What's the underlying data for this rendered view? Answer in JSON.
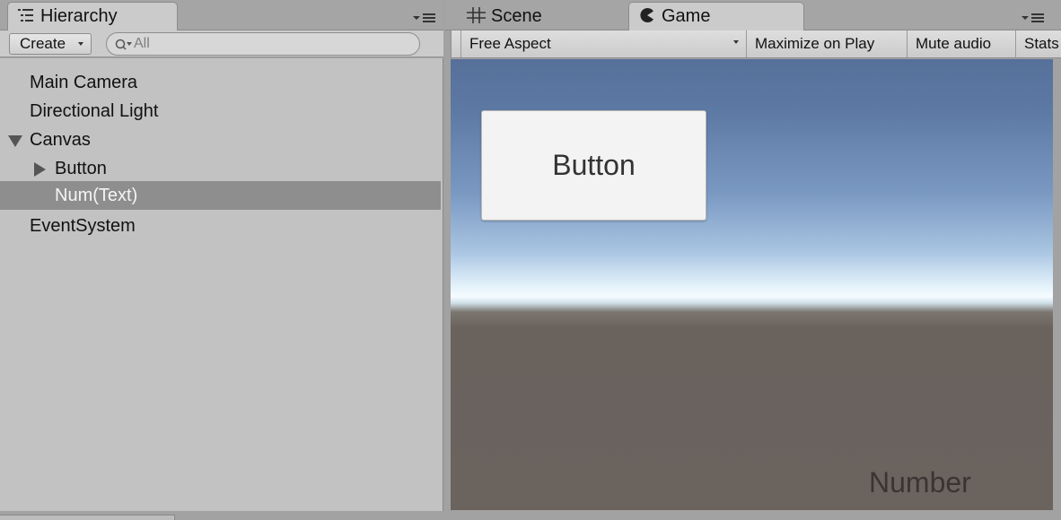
{
  "hierarchy": {
    "tab_label": "Hierarchy",
    "create_label": "Create",
    "search_placeholder": "All",
    "items": [
      {
        "label": "Main Camera"
      },
      {
        "label": "Directional Light"
      },
      {
        "label": "Canvas",
        "expanded": true
      },
      {
        "label": "Button",
        "expandable": true
      },
      {
        "label": "Num(Text)",
        "selected": true
      },
      {
        "label": "EventSystem"
      }
    ]
  },
  "tabs": {
    "scene_label": "Scene",
    "game_label": "Game"
  },
  "game_toolbar": {
    "aspect": "Free Aspect",
    "maximize": "Maximize on Play",
    "mute": "Mute audio",
    "stats": "Stats"
  },
  "game_view": {
    "button_text": "Button",
    "number_text": "Number"
  },
  "colors": {
    "panel_bg": "#c2c2c2",
    "selection": "#8e8e8e",
    "sky_top": "#56709a",
    "ground": "#6b635e"
  }
}
